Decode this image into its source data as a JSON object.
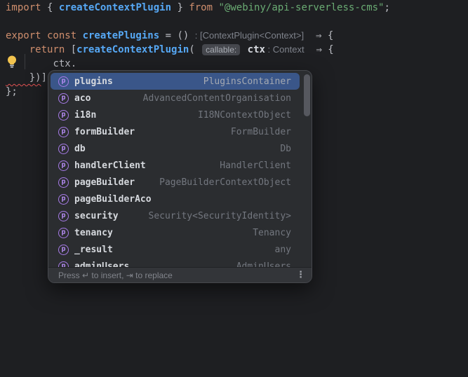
{
  "colors": {
    "editor_background": "#1e1f22",
    "keyword": "#cf8e6d",
    "function_name": "#56a8f5",
    "string": "#6aab73",
    "default_text": "#bcbec4",
    "inlay_hint": "#7e828b",
    "error_squiggle": "#e35252",
    "selection_blue": "#3a5689",
    "popup_background": "#2b2d30",
    "property_icon_purple": "#b48bf2",
    "bulb_yellow": "#f2c34e"
  },
  "code": {
    "lines": [
      {
        "tokens": [
          {
            "t": "import ",
            "c": "kw"
          },
          {
            "t": "{ ",
            "c": "pl"
          },
          {
            "t": "createContextPlugin",
            "c": "fn"
          },
          {
            "t": " } ",
            "c": "pl"
          },
          {
            "t": "from ",
            "c": "kw"
          },
          {
            "t": "\"@webiny/api-serverless-cms\"",
            "c": "str"
          },
          {
            "t": ";",
            "c": "pl"
          }
        ]
      },
      {
        "tokens": []
      },
      {
        "tokens": [
          {
            "t": "export const ",
            "c": "kw"
          },
          {
            "t": "createPlugins",
            "c": "fn"
          },
          {
            "t": " = () ",
            "c": "pl"
          },
          {
            "t": ": [ContextPlugin<Context>]",
            "c": "hint",
            "name": "return-type-hint"
          },
          {
            "t": "  ",
            "c": "pl"
          },
          {
            "t": "⇒",
            "c": "arrow",
            "name": "arrow-ligature"
          },
          {
            "t": " {",
            "c": "pl"
          }
        ]
      },
      {
        "tokens": [
          {
            "t": "    ",
            "c": "pl"
          },
          {
            "t": "return",
            "c": "kw"
          },
          {
            "t": " [",
            "c": "pl"
          },
          {
            "t": "createContextPlugin",
            "c": "fn"
          },
          {
            "t": "( ",
            "c": "pl"
          },
          {
            "t": "callable:",
            "c": "chip",
            "name": "callable-hint-chip"
          },
          {
            "t": " ",
            "c": "pl"
          },
          {
            "t": "ctx",
            "c": "param"
          },
          {
            "t": " : Context",
            "c": "hint",
            "name": "parameter-type-hint"
          },
          {
            "t": "  ",
            "c": "pl"
          },
          {
            "t": "⇒",
            "c": "arrow",
            "name": "arrow-ligature"
          },
          {
            "t": " {",
            "c": "pl"
          }
        ]
      },
      {
        "tokens": [
          {
            "t": "        ",
            "c": "pl"
          },
          {
            "t": "ctx",
            "c": "pl"
          },
          {
            "t": ".",
            "c": "sq",
            "name": "error-squiggle-dot"
          }
        ]
      },
      {
        "tokens": [
          {
            "t": "    })",
            "c": "sq",
            "name": "error-squiggle-brackets"
          },
          {
            "t": "];",
            "c": "pl"
          }
        ]
      },
      {
        "tokens": [
          {
            "t": "};",
            "c": "pl"
          }
        ]
      }
    ]
  },
  "popup": {
    "property_icon_glyph": "p",
    "items": [
      {
        "label": "plugins",
        "type": "PluginsContainer",
        "selected": true
      },
      {
        "label": "aco",
        "type": "AdvancedContentOrganisation",
        "selected": false
      },
      {
        "label": "i18n",
        "type": "I18NContextObject",
        "selected": false
      },
      {
        "label": "formBuilder",
        "type": "FormBuilder",
        "selected": false
      },
      {
        "label": "db",
        "type": "Db",
        "selected": false
      },
      {
        "label": "handlerClient",
        "type": "HandlerClient",
        "selected": false
      },
      {
        "label": "pageBuilder",
        "type": "PageBuilderContextObject",
        "selected": false
      },
      {
        "label": "pageBuilderAco",
        "type": "",
        "selected": false
      },
      {
        "label": "security",
        "type": "Security<SecurityIdentity>",
        "selected": false
      },
      {
        "label": "tenancy",
        "type": "Tenancy",
        "selected": false
      },
      {
        "label": "_result",
        "type": "any",
        "selected": false
      },
      {
        "label": "adminUsers",
        "type": "AdminUsers",
        "selected": false
      }
    ],
    "footer": {
      "hint": "Press ↵ to insert, ⇥ to replace",
      "menu_glyph": "⋮"
    }
  }
}
